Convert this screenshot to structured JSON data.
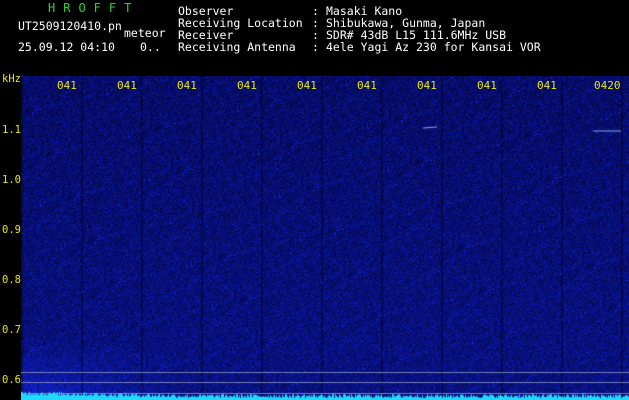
{
  "header": {
    "logo": "HROFFT",
    "filename": "UT2509120410.pn",
    "filename_suffix": "meteor",
    "timestamp": "25.09.12 04:10",
    "extra_value": "0..",
    "info": [
      {
        "label": "Observer",
        "value": "Masaki Kano"
      },
      {
        "label": "Receiving Location",
        "value": "Shibukawa, Gunma, Japan"
      },
      {
        "label": "Receiver",
        "value": "SDR# 43dB L15 111.6MHz USB"
      },
      {
        "label": "Receiving Antenna",
        "value": "4ele Yagi Az 230 for Kansai VOR"
      }
    ],
    "separator": ": "
  },
  "colors": {
    "header_green": "#2bd52b",
    "axis_yellow": "#e8e800",
    "noise_blue": "#2a35ff",
    "floor_cyan": "#22d8ff",
    "background": "#000000"
  },
  "chart_data": {
    "type": "heatmap",
    "y_unit": "kHz",
    "y_ticks": [
      "1.1",
      "1.0",
      "0.9",
      "0.8",
      "0.7",
      "0.6"
    ],
    "y_range": [
      0.57,
      1.17
    ],
    "x_ticks": [
      "041",
      "041",
      "041",
      "041",
      "041",
      "041",
      "041",
      "041",
      "041",
      "0420"
    ],
    "horizontal_lines_khz": [
      0.583,
      0.603,
      0.621
    ]
  }
}
